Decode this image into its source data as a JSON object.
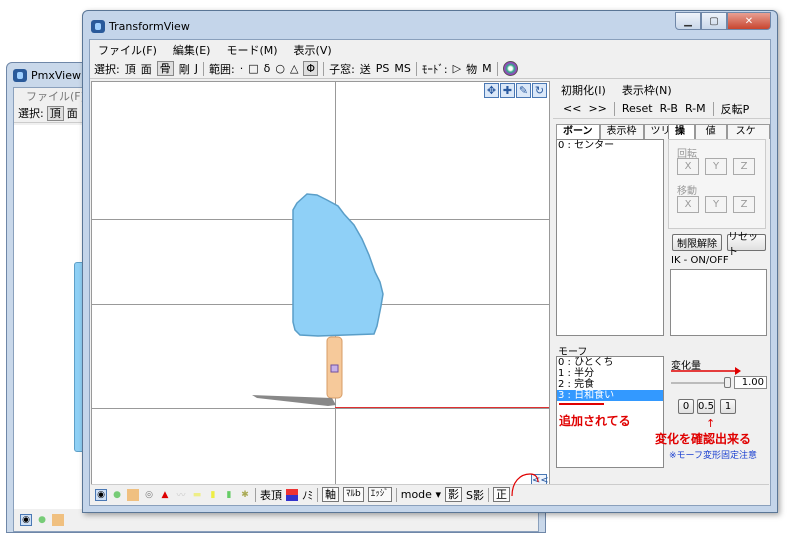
{
  "pmx": {
    "title": "PmxView *",
    "menu": "ファイル(F)",
    "select_label": "選択:",
    "vertex": "頂",
    "face": "面"
  },
  "tv": {
    "title": "TransformView",
    "menu": [
      "ファイル(F)",
      "編集(E)",
      "モード(M)",
      "表示(V)"
    ],
    "toolbar": {
      "select_label": "選択:",
      "vertex": "頂",
      "face": "面",
      "bone": "骨",
      "rigid": "剛",
      "joint": "J",
      "range_label": "範囲:",
      "child_window_label": "子窓:",
      "send": "送",
      "ps": "PS",
      "ms": "MS",
      "mode_label": "ﾓｰﾄﾞ:",
      "object": "物",
      "m": "M"
    },
    "bottom": {
      "hyoji": "表頂",
      "nomi": "ﾉﾐ",
      "axis": "軸",
      "nabo": "ﾏﾙb",
      "edge": "ｴｯｼﾞ",
      "mode": "mode",
      "shadow": "影",
      "s_shadow": "S影",
      "front": "正"
    },
    "collapse": "<<"
  },
  "right_panel": {
    "menu": [
      "初期化(I)",
      "表示枠(N)"
    ],
    "row2": [
      "<<",
      ">>",
      "Reset",
      "R-B",
      "R-M",
      "反転P"
    ],
    "bone_tabs": [
      "ボーン",
      "表示枠",
      "ツリー"
    ],
    "bone_list": [
      "0 : センター"
    ],
    "op_tabs": [
      "操作",
      "値",
      "スケール"
    ],
    "rotate_label": "回転",
    "move_label": "移動",
    "axes": [
      "X",
      "Y",
      "Z"
    ],
    "limit_release": "制限解除",
    "reset": "リセット",
    "ik_label": "IK - ON/OFF",
    "morph_label": "モーフ",
    "morph_list": [
      "0 : ひとくち",
      "1 : 半分",
      "2 : 完食",
      "3 : 日和食い"
    ],
    "selected_morph": 3,
    "change_amount_label": "変化量",
    "slider_value": 1.0,
    "value_text": "1.00",
    "preset_buttons": [
      "0",
      "0.5",
      "1"
    ],
    "note": "※モーフ変形固定注意"
  },
  "annotations": {
    "added": "追加されてる",
    "confirm": "変化を確認出来る",
    "accent": "#e00000"
  }
}
